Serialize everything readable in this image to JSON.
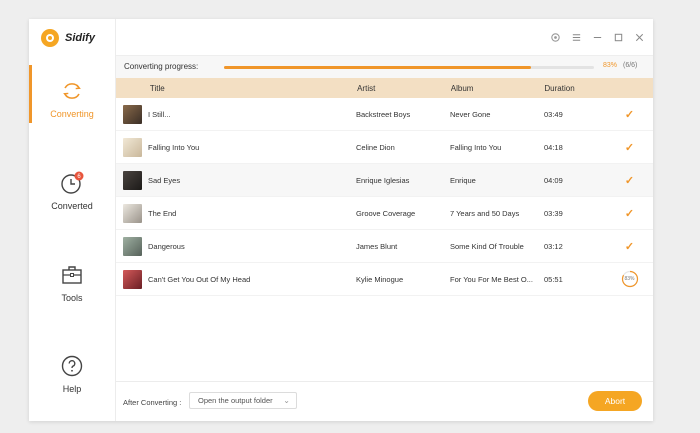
{
  "app": {
    "name": "Sidify",
    "accent": "#f0962a"
  },
  "sidebar": {
    "items": [
      {
        "label": "Converting",
        "icon": "converting-icon",
        "active": true
      },
      {
        "label": "Converted",
        "icon": "clock-icon",
        "badge": "6"
      },
      {
        "label": "Tools",
        "icon": "toolbox-icon"
      },
      {
        "label": "Help",
        "icon": "question-icon"
      }
    ]
  },
  "window_controls": [
    "settings-icon",
    "menu-icon",
    "minimize-icon",
    "maximize-icon",
    "close-icon"
  ],
  "progress": {
    "label": "Converting progress:",
    "percent_text": "83%",
    "count_text": "(6/6)",
    "fraction": 0.83
  },
  "table": {
    "headers": {
      "title": "Title",
      "artist": "Artist",
      "album": "Album",
      "duration": "Duration"
    },
    "rows": [
      {
        "title": "I Still...",
        "artist": "Backstreet Boys",
        "album": "Never Gone",
        "duration": "03:49",
        "status": "done",
        "thumb": "#5a4a3a"
      },
      {
        "title": "Falling Into You",
        "artist": "Celine Dion",
        "album": "Falling Into You",
        "duration": "04:18",
        "status": "done",
        "thumb": "#e8dcc8"
      },
      {
        "title": "Sad Eyes",
        "artist": "Enrique Iglesias",
        "album": "Enrique",
        "duration": "04:09",
        "status": "done",
        "thumb": "#2e2a28"
      },
      {
        "title": "The End",
        "artist": "Groove Coverage",
        "album": "7 Years and 50 Days",
        "duration": "03:39",
        "status": "done",
        "thumb": "#d8d4cc"
      },
      {
        "title": "Dangerous",
        "artist": "James Blunt",
        "album": "Some Kind Of Trouble",
        "duration": "03:12",
        "status": "done",
        "thumb": "#7a8a7c"
      },
      {
        "title": "Can't Get You Out Of My Head",
        "artist": "Kylie Minogue",
        "album": "For You For Me Best O...",
        "duration": "05:51",
        "status": "progress",
        "progress_text": "83%",
        "progress_fraction": 0.83,
        "thumb": "#b4424a"
      }
    ]
  },
  "footer": {
    "after_label": "After Converting :",
    "after_value": "Open the output folder",
    "abort_label": "Abort"
  }
}
